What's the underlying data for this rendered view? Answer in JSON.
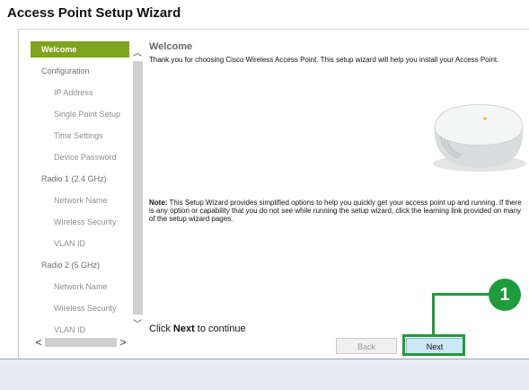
{
  "window": {
    "title": "Access Point Setup Wizard"
  },
  "sidebar": {
    "items": [
      {
        "label": "Welcome"
      },
      {
        "label": "Configuration"
      },
      {
        "label": "IP Address"
      },
      {
        "label": "Single Point Setup"
      },
      {
        "label": "Time Settings"
      },
      {
        "label": "Device Password"
      },
      {
        "label": "Radio 1 (2.4 GHz)"
      },
      {
        "label": "Network Name"
      },
      {
        "label": "Wireless Security"
      },
      {
        "label": "VLAN ID"
      },
      {
        "label": "Radio 2 (5 GHz)"
      },
      {
        "label": "Network Name"
      },
      {
        "label": "Wireless Security"
      },
      {
        "label": "VLAN ID"
      }
    ],
    "active": "Welcome"
  },
  "content": {
    "title": "Welcome",
    "intro": "Thank you for choosing Cisco Wireless Access Point. This setup wizard will help you install your Access Point.",
    "note_label": "Note:",
    "note_text": " This Setup Wizard provides simplified options to help you quickly get your access point up and running. If there is any option or capability that you do not see while running the setup wizard, click the learning link provided on many of the setup wizard pages.",
    "continue_prefix": "Click ",
    "continue_bold": "Next",
    "continue_suffix": " to continue"
  },
  "buttons": {
    "back": "Back",
    "next": "Next"
  },
  "callout": {
    "number": "1",
    "color": "#1e9b3a"
  },
  "colors": {
    "active_nav": "#7ea31c",
    "next_button": "#cfe6f5"
  }
}
